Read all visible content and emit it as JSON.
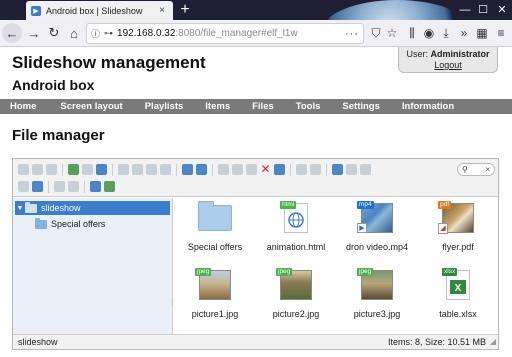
{
  "browser": {
    "tab_title": "Android box | Slideshow",
    "tab_close": "×",
    "new_tab": "+",
    "url_host": "192.168.0.32",
    "url_rest": ":8080/file_manager#elf_l1w",
    "url_dots": "···",
    "window_controls": [
      "—",
      "☐",
      "✕"
    ]
  },
  "header": {
    "title": "Slideshow management",
    "subtitle": "Android box",
    "user_label": "User:",
    "user_name": "Administrator",
    "logout": "Logout"
  },
  "menu": {
    "items": [
      "Home",
      "Screen layout",
      "Playlists",
      "Items",
      "Files",
      "Tools",
      "Settings",
      "Information"
    ]
  },
  "file_manager": {
    "title": "File manager",
    "search_icon": "⚲",
    "search_clear": "×",
    "tree": [
      {
        "label": "slideshow",
        "selected": true
      },
      {
        "label": "Special offers",
        "selected": false
      }
    ],
    "files": [
      {
        "name": "Special offers",
        "kind": "folder",
        "badge": ""
      },
      {
        "name": "animation.html",
        "kind": "html",
        "badge": "html"
      },
      {
        "name": "dron video.mp4",
        "kind": "video",
        "badge": "mp4"
      },
      {
        "name": "flyer.pdf",
        "kind": "pdf",
        "badge": "pdf"
      },
      {
        "name": "picture1.jpg",
        "kind": "image",
        "badge": "jpeg"
      },
      {
        "name": "picture2.jpg",
        "kind": "image",
        "badge": "jpeg"
      },
      {
        "name": "picture3.jpg",
        "kind": "image",
        "badge": "jpeg"
      },
      {
        "name": "table.xlsx",
        "kind": "xlsx",
        "badge": "xlsx"
      }
    ],
    "status": {
      "path": "slideshow",
      "info": "Items: 8, Size: 10.51 MB"
    }
  },
  "colors": {
    "menu_bg": "#7a7a7a",
    "tree_selected": "#3b7ecd",
    "badge_html": "#4caf50",
    "badge_mp4": "#1e6fd9",
    "badge_pdf": "#e07b1f",
    "badge_jpeg": "#4caf50",
    "badge_xlsx": "#2e8b3e"
  }
}
